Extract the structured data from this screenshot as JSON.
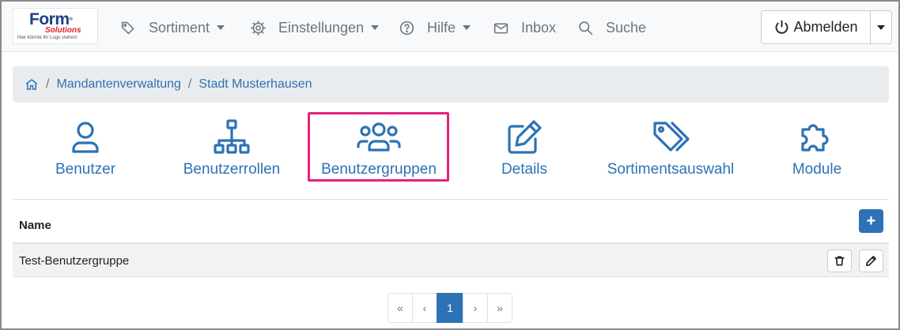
{
  "logo": {
    "brand": "Form",
    "brand_mark": "®",
    "sub": "Solutions",
    "tagline": "Hier könnte Ihr Logo stehen!"
  },
  "nav": {
    "items": [
      {
        "label": "Sortiment",
        "icon": "tags-icon",
        "dropdown": true
      },
      {
        "label": "Einstellungen",
        "icon": "gear-icon",
        "dropdown": true
      },
      {
        "label": "Hilfe",
        "icon": "question-circle-icon",
        "dropdown": true
      },
      {
        "label": "Inbox",
        "icon": "envelope-icon",
        "dropdown": false
      },
      {
        "label": "Suche",
        "icon": "search-icon",
        "dropdown": false
      }
    ],
    "logout_label": "Abmelden"
  },
  "breadcrumb": {
    "home_icon": "house-icon",
    "items": [
      "Mandantenverwaltung",
      "Stadt Musterhausen"
    ]
  },
  "tiles": {
    "items": [
      {
        "label": "Benutzer",
        "icon": "person-icon"
      },
      {
        "label": "Benutzerrollen",
        "icon": "sitemap-icon"
      },
      {
        "label": "Benutzergruppen",
        "icon": "users-icon",
        "active": true
      },
      {
        "label": "Details",
        "icon": "edit-icon"
      },
      {
        "label": "Sortimentsauswahl",
        "icon": "tags-icon"
      },
      {
        "label": "Module",
        "icon": "puzzle-icon"
      }
    ],
    "highlight_color": "#e5217f"
  },
  "table": {
    "header_name": "Name",
    "add_label": "+",
    "rows": [
      {
        "name": "Test-Benutzergruppe"
      }
    ]
  },
  "pagination": {
    "first": "«",
    "prev": "‹",
    "current": "1",
    "next": "›",
    "last": "»"
  },
  "colors": {
    "accent": "#2d72b5",
    "muted": "#6c757d",
    "highlight": "#e5217f"
  }
}
